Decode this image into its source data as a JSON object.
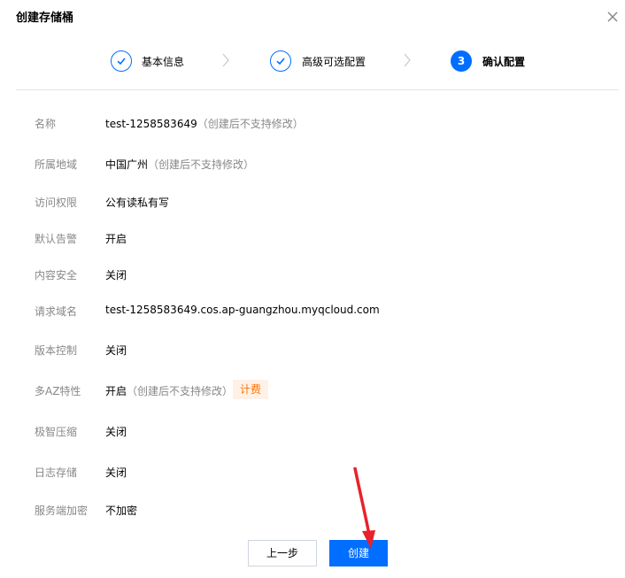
{
  "dialog": {
    "title": "创建存储桶"
  },
  "steps": [
    {
      "label": "基本信息",
      "state": "done"
    },
    {
      "label": "高级可选配置",
      "state": "done"
    },
    {
      "number": "3",
      "label": "确认配置",
      "state": "active"
    }
  ],
  "rows": {
    "name": {
      "label": "名称",
      "value": "test-1258583649",
      "note": "（创建后不支持修改）"
    },
    "region": {
      "label": "所属地域",
      "value": "中国广州",
      "note": "（创建后不支持修改）"
    },
    "access": {
      "label": "访问权限",
      "value": "公有读私有写"
    },
    "alarm": {
      "label": "默认告警",
      "value": "开启"
    },
    "content_security": {
      "label": "内容安全",
      "value": "关闭"
    },
    "domain": {
      "label": "请求域名",
      "value": "test-1258583649.cos.ap-guangzhou.myqcloud.com"
    },
    "versioning": {
      "label": "版本控制",
      "value": "关闭"
    },
    "multi_az": {
      "label": "多AZ特性",
      "value": "开启",
      "note": "（创建后不支持修改）",
      "badge": "计费"
    },
    "compression": {
      "label": "极智压缩",
      "value": "关闭"
    },
    "logging": {
      "label": "日志存储",
      "value": "关闭"
    },
    "encryption": {
      "label": "服务端加密",
      "value": "不加密"
    }
  },
  "buttons": {
    "prev": "上一步",
    "create": "创建"
  },
  "colors": {
    "primary": "#006eff",
    "muted": "#888888",
    "badge_bg": "#fff1e6",
    "badge_text": "#ff7200",
    "arrow": "#e8222a"
  }
}
